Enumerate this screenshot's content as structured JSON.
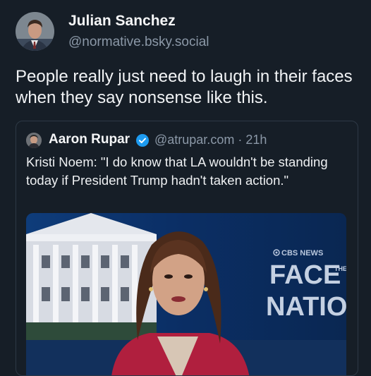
{
  "post": {
    "author_name": "Julian Sanchez",
    "author_handle": "@normative.bsky.social",
    "text": "People really just need to laugh in their faces when they say nonsense like this."
  },
  "quote": {
    "author_name": "Aaron Rupar",
    "author_handle": "@atrupar.com",
    "separator": "·",
    "time": "21h",
    "meta": "@atrupar.com · 21h",
    "text": "Kristi Noem: \"I do know that LA wouldn't be standing today if President Trump hadn't taken action.\"",
    "media": {
      "network": "CBS NEWS",
      "show_line1": "FACE",
      "show_the": "THE",
      "show_line2": "NATION"
    }
  },
  "icons": {
    "verified": "verified-badge-icon"
  },
  "colors": {
    "background": "#161e27",
    "handle": "#8b98a7",
    "verified": "#1d9bf0",
    "border": "#2e3946"
  }
}
